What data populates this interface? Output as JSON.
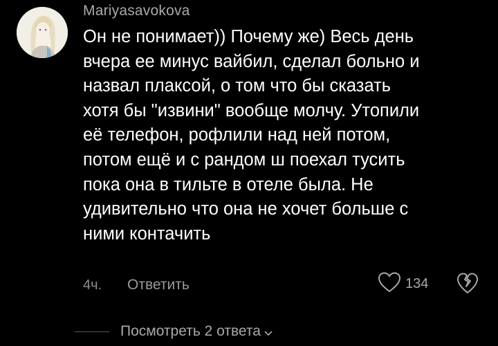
{
  "comment": {
    "username": "Mariyasavokova",
    "text": "Он не понимает)) Почему же) Весь день\nвчера ее минус вайбил, сделал больно и\nназвал плаксой, о том что бы сказать\nхотя бы \"извини\" вообще молчу. Утопили\nеё телефон, рофлили над ней потом,\nпотом ещё и с рандом ш поехал тусить\nпока она в тильте в отеле была. Не\nудивительно что она не хочет больше с\nними контачить",
    "time": "4ч.",
    "reply_label": "Ответить",
    "like_count": "134",
    "view_replies_label": "Посмотреть 2 ответа"
  },
  "icons": {
    "avatar": "avatar",
    "like": "heart-icon",
    "dislike": "broken-heart-icon",
    "expand": "chevron-down-icon"
  },
  "colors": {
    "background": "#000000",
    "text": "#ffffff",
    "muted": "#a9a9a9",
    "divider": "#5a5a5a"
  }
}
